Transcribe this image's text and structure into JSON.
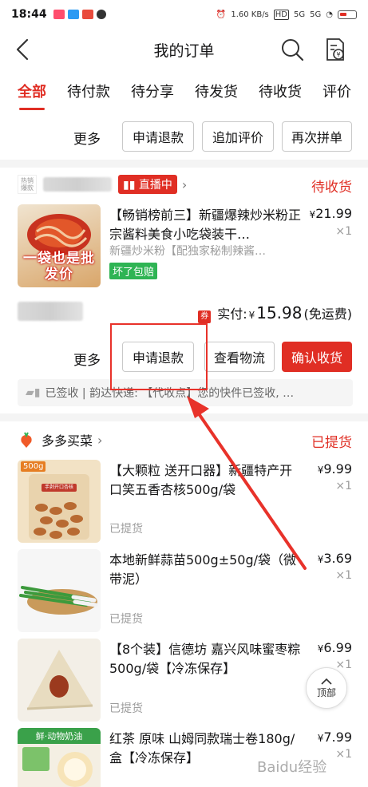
{
  "status_bar": {
    "time": "18:44",
    "network_speed": "1.60 KB/s",
    "hd_label": "HD",
    "signal_1": "5G",
    "signal_2": "5G"
  },
  "header": {
    "title": "我的订单"
  },
  "tabs": [
    {
      "label": "全部",
      "active": true
    },
    {
      "label": "待付款",
      "active": false
    },
    {
      "label": "待分享",
      "active": false
    },
    {
      "label": "待发货",
      "active": false
    },
    {
      "label": "待收货",
      "active": false
    },
    {
      "label": "评价",
      "active": false
    }
  ],
  "order0_actions": {
    "more": "更多",
    "refund": "申请退款",
    "review": "追加评价",
    "reorder": "再次拼单"
  },
  "order1": {
    "store_logo_text": "热销爆款",
    "live_label": "直播中",
    "status": "待收货",
    "product_title": "【畅销榜前三】新疆爆辣炒米粉正宗酱料美食小吃袋装干…",
    "product_sub": "新疆炒米粉【配独家秘制辣酱…",
    "tag": "坏了包赔",
    "price": "21.99",
    "qty": "×1",
    "image_text": "一袋也是批发价",
    "pay_label": "实付:",
    "pay_currency": "¥",
    "pay_amount": "15.98",
    "shipping_note": "(免运费)",
    "coupon_char": "券",
    "actions": {
      "more": "更多",
      "refund": "申请退款",
      "logistics": "查看物流",
      "confirm": "确认收货"
    },
    "logistics_text": "已签收 | 韵达快递: 【代收点】您的快件已签收, …"
  },
  "order2": {
    "store_name": "多多买菜",
    "status": "已提货",
    "items": [
      {
        "title": "【大颗粒 送开口器】新疆特产开口笑五香杏核500g/袋",
        "price": "9.99",
        "qty": "×1",
        "state": "已提货",
        "badge": "500g",
        "bag_text": "手剥开口杏核"
      },
      {
        "title": "本地新鲜蒜苗500g±50g/袋（微带泥）",
        "price": "3.69",
        "qty": "×1",
        "state": "已提货"
      },
      {
        "title": "【8个装】信德坊 嘉兴风味蜜枣粽500g/袋【冷冻保存】",
        "price": "6.99",
        "qty": "×1",
        "state": "已提货"
      },
      {
        "title": "红茶 原味 山姆同款瑞士卷180g/盒【冷冻保存】",
        "price": "7.99",
        "qty": "×1",
        "badge": "鲜·动物奶油"
      }
    ]
  },
  "back_to_top": "顶部",
  "currency": "¥",
  "colors": {
    "brand_red": "#e02e24",
    "green_tag": "#2fb454",
    "annotation_red": "#e8322a"
  },
  "watermark": "Baidu经验"
}
